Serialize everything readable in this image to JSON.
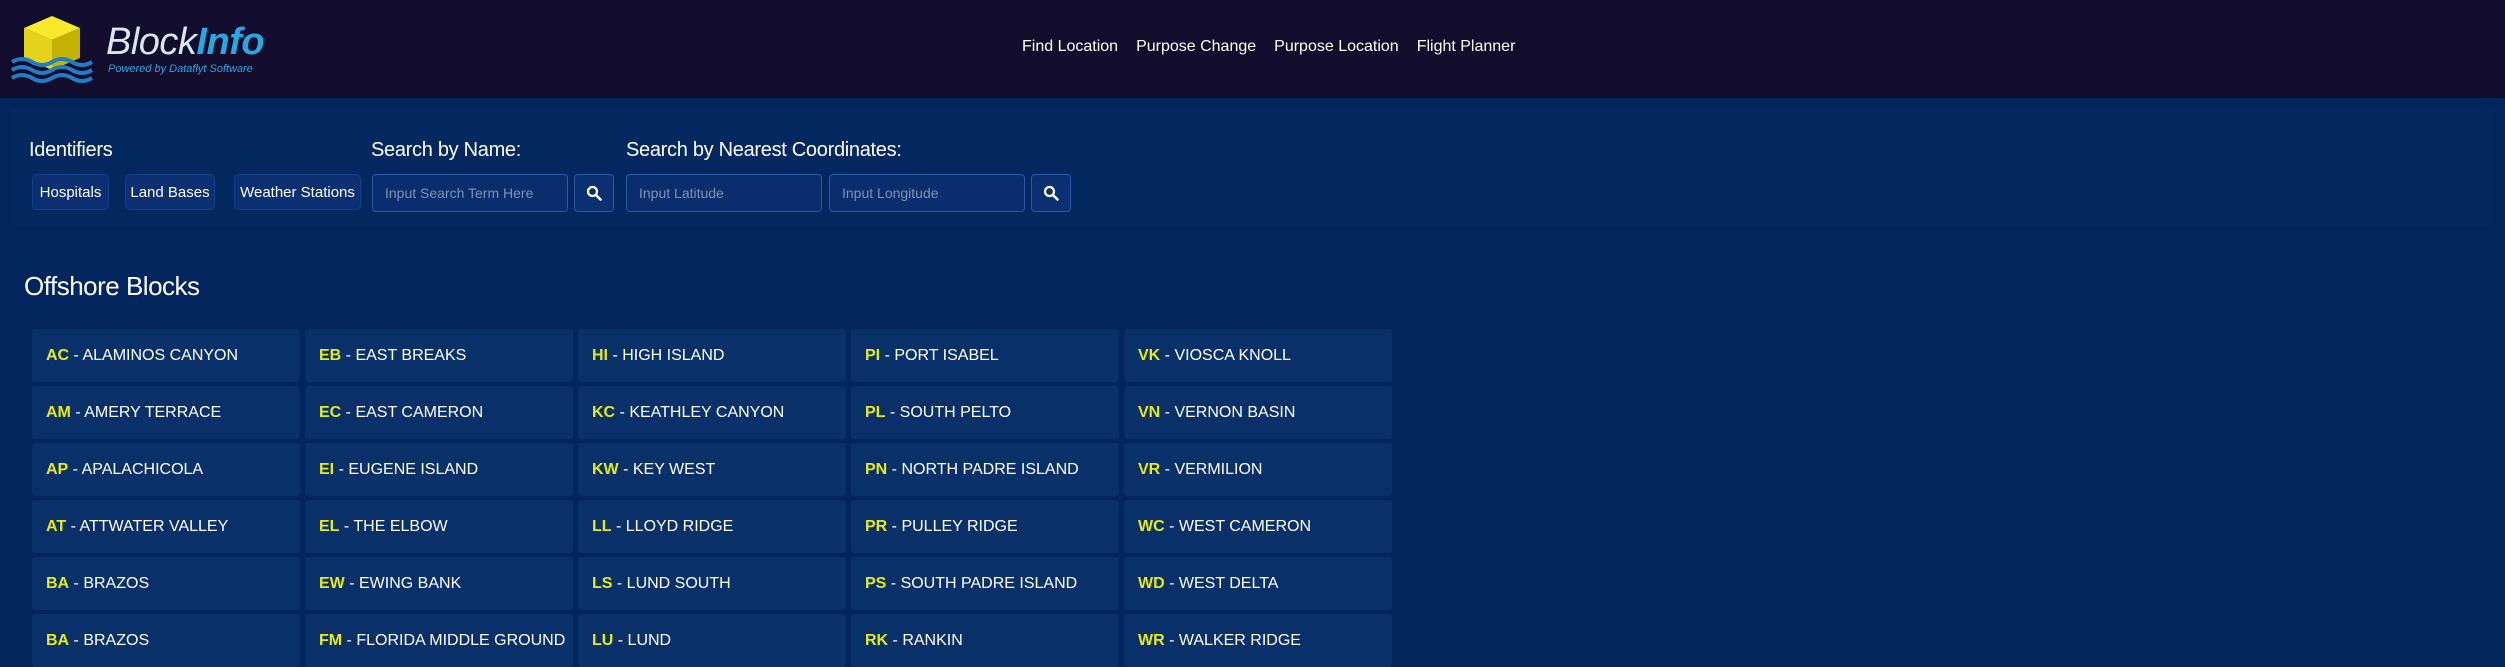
{
  "brand": {
    "name_light": "Block",
    "name_bold": "Info",
    "tagline": "Powered by Dataflyt Software",
    "colors": {
      "accent": "#27a8e0",
      "cube_top": "#f2e71c",
      "cube_side": "#c8b400",
      "waves": "#1f7fc6"
    }
  },
  "nav": {
    "items": [
      "Find Location",
      "Purpose Change",
      "Purpose Location",
      "Flight Planner"
    ]
  },
  "search": {
    "identifiers": {
      "title": "Identifiers",
      "chips": [
        "Hospitals",
        "Land Bases",
        "Weather Stations"
      ]
    },
    "by_name": {
      "title": "Search by Name:",
      "placeholder": "Input Search Term Here",
      "button_icon": "search-icon"
    },
    "by_coordinates": {
      "title": "Search by Nearest Coordinates:",
      "lat_placeholder": "Input Latitude",
      "lon_placeholder": "Input Longitude",
      "button_icon": "search-icon"
    }
  },
  "offshore": {
    "title": "Offshore Blocks",
    "separator": " - ",
    "columns": [
      [
        {
          "code": "AC",
          "name": "ALAMINOS CANYON"
        },
        {
          "code": "AM",
          "name": "AMERY TERRACE"
        },
        {
          "code": "AP",
          "name": "APALACHICOLA"
        },
        {
          "code": "AT",
          "name": "ATTWATER VALLEY"
        },
        {
          "code": "BA",
          "name": "BRAZOS"
        },
        {
          "code": "BA",
          "name": "BRAZOS"
        }
      ],
      [
        {
          "code": "EB",
          "name": "EAST BREAKS"
        },
        {
          "code": "EC",
          "name": "EAST CAMERON"
        },
        {
          "code": "EI",
          "name": "EUGENE ISLAND"
        },
        {
          "code": "EL",
          "name": "THE ELBOW"
        },
        {
          "code": "EW",
          "name": "EWING BANK"
        },
        {
          "code": "FM",
          "name": "FLORIDA MIDDLE GROUND"
        }
      ],
      [
        {
          "code": "HI",
          "name": "HIGH ISLAND"
        },
        {
          "code": "KC",
          "name": "KEATHLEY CANYON"
        },
        {
          "code": "KW",
          "name": "KEY WEST"
        },
        {
          "code": "LL",
          "name": "LLOYD RIDGE"
        },
        {
          "code": "LS",
          "name": "LUND SOUTH"
        },
        {
          "code": "LU",
          "name": "LUND"
        }
      ],
      [
        {
          "code": "PI",
          "name": "PORT ISABEL"
        },
        {
          "code": "PL",
          "name": "SOUTH PELTO"
        },
        {
          "code": "PN",
          "name": "NORTH PADRE ISLAND"
        },
        {
          "code": "PR",
          "name": "PULLEY RIDGE"
        },
        {
          "code": "PS",
          "name": "SOUTH PADRE ISLAND"
        },
        {
          "code": "RK",
          "name": "RANKIN"
        }
      ],
      [
        {
          "code": "VK",
          "name": "VIOSCA KNOLL"
        },
        {
          "code": "VN",
          "name": "VERNON BASIN"
        },
        {
          "code": "VR",
          "name": "VERMILION"
        },
        {
          "code": "WC",
          "name": "WEST CAMERON"
        },
        {
          "code": "WD",
          "name": "WEST DELTA"
        },
        {
          "code": "WR",
          "name": "WALKER RIDGE"
        }
      ]
    ]
  }
}
